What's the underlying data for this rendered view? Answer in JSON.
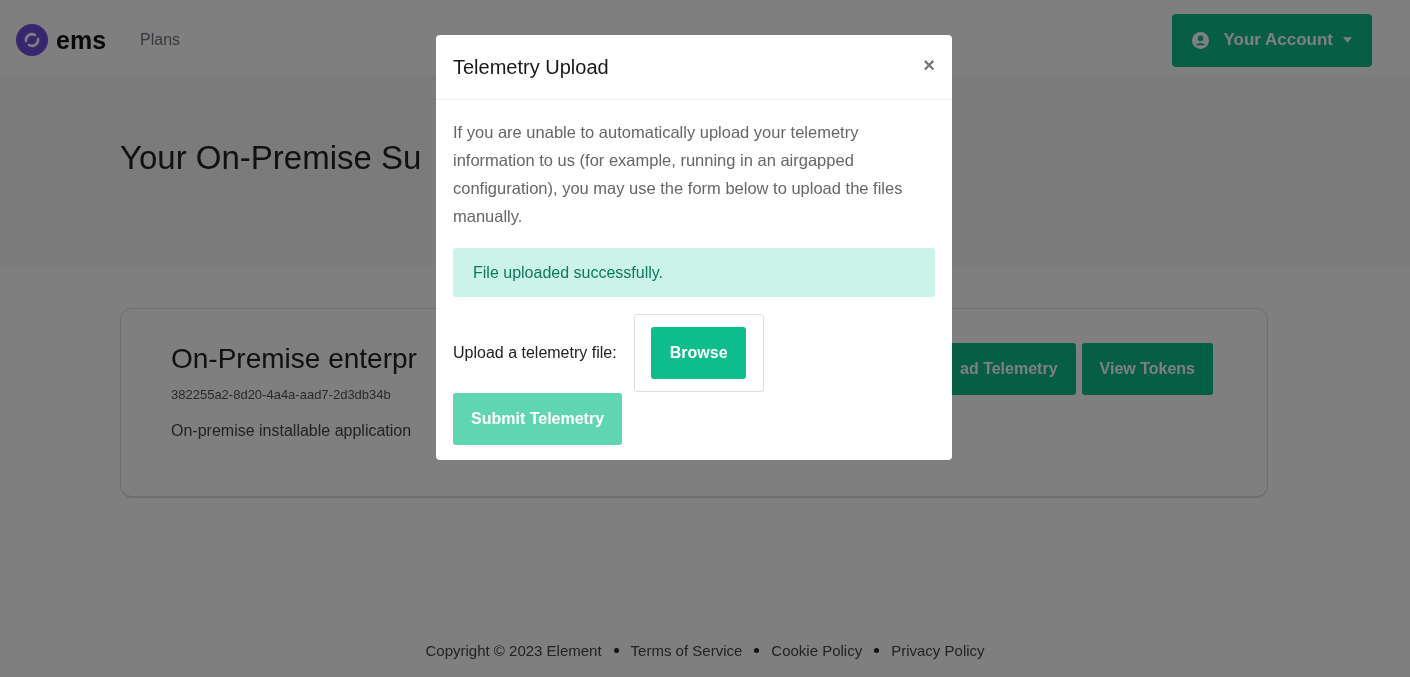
{
  "header": {
    "brand": "ems",
    "nav": [
      {
        "label": "Plans",
        "selected": false
      }
    ],
    "account_button": "Your Account"
  },
  "page_title": "Your On-Premise Su",
  "subscription": {
    "title": "On-Premise enterpr",
    "id": "382255a2-8d20-4a4a-aad7-2d3db34b",
    "description": "On-premise installable application",
    "buttons": [
      "ad Telemetry",
      "View Tokens"
    ]
  },
  "footer": [
    "Copyright © 2023 Element",
    "Terms of Service",
    "Cookie Policy",
    "Privacy Policy"
  ],
  "modal": {
    "title": "Telemetry Upload",
    "close": "×",
    "text": "If you are unable to automatically upload your telemetry information to us (for example, running in an airgapped configuration), you may use the form below to upload the files manually.",
    "alert": "File uploaded successfully.",
    "file_label": "Upload a telemetry file:",
    "browse": "Browse",
    "submit": {
      "label": "Submit Telemetry",
      "disabled": true
    }
  }
}
